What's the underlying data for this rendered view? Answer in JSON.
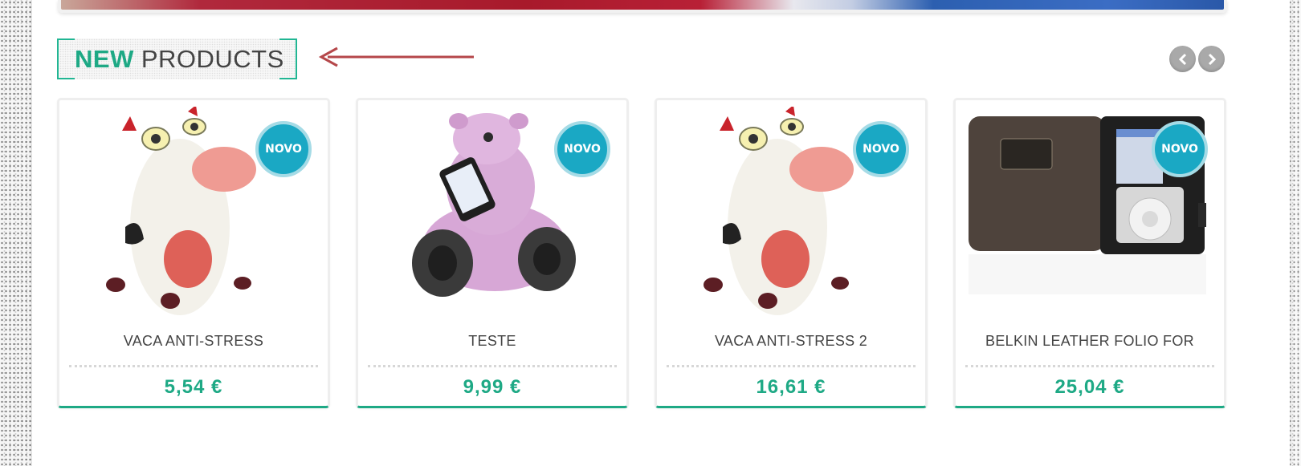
{
  "section": {
    "heading_strong": "NEW",
    "heading_rest": "PRODUCTS"
  },
  "carousel": {
    "prev_icon": "chevron-left-icon",
    "next_icon": "chevron-right-icon"
  },
  "colors": {
    "accent": "#1ea985",
    "badge": "#1aa8c4",
    "annotation_arrow": "#b5474a"
  },
  "products": [
    {
      "name": "VACA ANTI-STRESS",
      "price": "5,54 €",
      "badge": "NOVO",
      "image": "toy-cow"
    },
    {
      "name": "TESTE",
      "price": "9,99 €",
      "badge": "NOVO",
      "image": "pink-bear-speaker"
    },
    {
      "name": "VACA ANTI-STRESS 2",
      "price": "16,61 €",
      "badge": "NOVO",
      "image": "toy-cow"
    },
    {
      "name": "BELKIN LEATHER FOLIO FOR",
      "price": "25,04 €",
      "badge": "NOVO",
      "image": "ipod-leather-folio"
    }
  ]
}
